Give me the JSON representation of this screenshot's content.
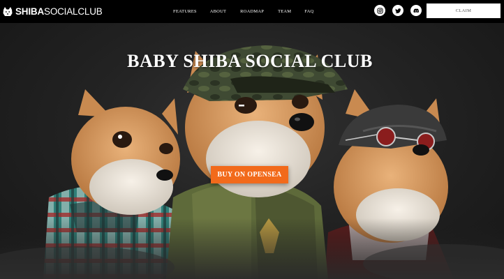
{
  "brand": {
    "name_bold": "SHIBA",
    "name_light": "SOCIALCLUB"
  },
  "nav": {
    "items": [
      {
        "label": "FEATURES"
      },
      {
        "label": "ABOUT"
      },
      {
        "label": "ROADMAP"
      },
      {
        "label": "TEAM"
      },
      {
        "label": "FAQ"
      }
    ],
    "social": [
      {
        "icon": "instagram-icon"
      },
      {
        "icon": "twitter-icon"
      },
      {
        "icon": "discord-icon"
      }
    ],
    "claim_label": "CLAIM"
  },
  "hero": {
    "title": "BABY SHIBA SOCIAL CLUB",
    "cta_label": "BUY ON OPENSEA"
  },
  "colors": {
    "nav_bg": "#000000",
    "hero_bg": "#1b1b1b",
    "cta": "#f26a1b",
    "text": "#ffffff"
  }
}
